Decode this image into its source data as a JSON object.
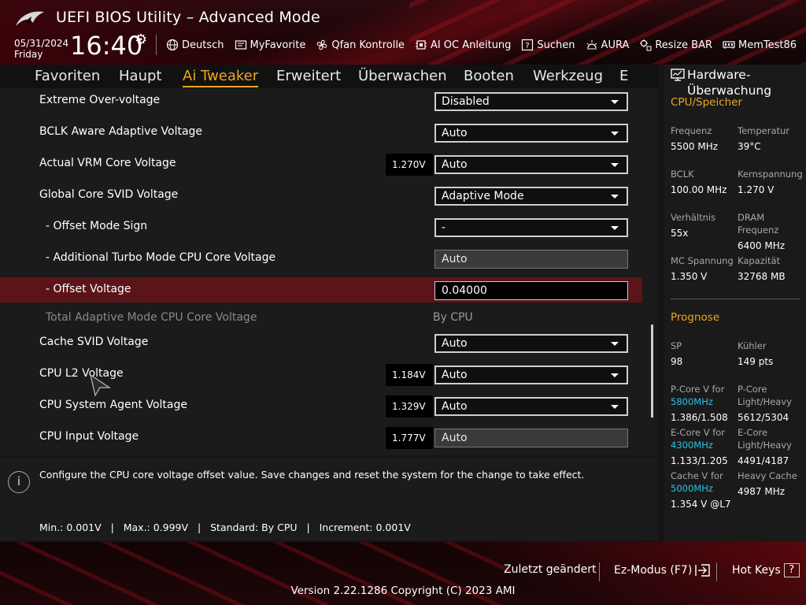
{
  "header": {
    "title": "UEFI BIOS Utility – Advanced Mode",
    "date": "05/31/2024",
    "day": "Friday",
    "time": "16:40",
    "quick_items": [
      {
        "icon": "globe-icon",
        "label": "Deutsch"
      },
      {
        "icon": "myfavorite-icon",
        "label": "MyFavorite"
      },
      {
        "icon": "fan-icon",
        "label": "Qfan Kontrolle"
      },
      {
        "icon": "ai-chip-icon",
        "label": "AI OC Anleitung"
      },
      {
        "icon": "search-help-icon",
        "label": "Suchen"
      },
      {
        "icon": "aura-lighting-icon",
        "label": "AURA"
      },
      {
        "icon": "resize-bar-icon",
        "label": "Resize BAR"
      },
      {
        "icon": "memtest-icon",
        "label": "MemTest86"
      }
    ]
  },
  "nav": {
    "tabs": [
      "Favoriten",
      "Haupt",
      "Ai Tweaker",
      "Erweitert",
      "Überwachen",
      "Booten",
      "Werkzeug",
      "E"
    ],
    "active": "Ai Tweaker"
  },
  "settings": [
    {
      "label": "Extreme Over-voltage",
      "type": "dropdown",
      "value": "Disabled"
    },
    {
      "label": "BCLK Aware Adaptive Voltage",
      "type": "dropdown",
      "value": "Auto"
    },
    {
      "label": "Actual VRM Core Voltage",
      "type": "dropdown",
      "value": "Auto",
      "reading": "1.270V"
    },
    {
      "label": "Global Core SVID Voltage",
      "type": "dropdown",
      "value": "Adaptive Mode"
    },
    {
      "label": "- Offset Mode Sign",
      "type": "dropdown",
      "value": "-"
    },
    {
      "label": "- Additional Turbo Mode CPU Core Voltage",
      "type": "field",
      "value": "Auto"
    },
    {
      "label": "- Offset Voltage",
      "type": "input",
      "value": "0.04000",
      "highlighted": true
    },
    {
      "label": "Total Adaptive Mode CPU Core Voltage",
      "type": "static",
      "value": "By CPU"
    },
    {
      "label": "Cache SVID Voltage",
      "type": "dropdown",
      "value": "Auto"
    },
    {
      "label": "CPU L2 Voltage",
      "type": "dropdown",
      "value": "Auto",
      "reading": "1.184V"
    },
    {
      "label": "CPU System Agent Voltage",
      "type": "dropdown",
      "value": "Auto",
      "reading": "1.329V"
    },
    {
      "label": "CPU Input Voltage",
      "type": "field",
      "value": "Auto",
      "reading": "1.777V"
    }
  ],
  "info": {
    "text": "Configure the CPU core voltage offset value. Save changes and reset the system for the change to take effect.",
    "limits": "Min.: 0.001V   |   Max.: 0.999V   |   Standard: By CPU   |   Increment: 0.001V"
  },
  "hw": {
    "title": "Hardware-Überwachung",
    "cpu_section": "CPU/Speicher",
    "frequenz_label": "Frequenz",
    "frequenz": "5500 MHz",
    "temperatur_label": "Temperatur",
    "temperatur": "39°C",
    "bclk_label": "BCLK",
    "bclk": "100.00 MHz",
    "kernspannung_label": "Kernspannung",
    "kernspannung": "1.270 V",
    "verhaeltnis_label": "Verhältnis",
    "verhaeltnis": "55x",
    "dram_label": "DRAM Frequenz",
    "dram": "6400 MHz",
    "mc_label": "MC Spannung",
    "mc": "1.350 V",
    "kapazitaet_label": "Kapazität",
    "kapazitaet": "32768 MB",
    "prognose_section": "Prognose",
    "sp_label": "SP",
    "sp": "98",
    "kuehler_label": "Kühler",
    "kuehler": "149 pts",
    "pcore_label": "P-Core V for",
    "pcore_freq": "5800MHz",
    "pcore": "1.386/1.508",
    "pcore_lh_label": "P-Core Light/Heavy",
    "pcore_lh": "5612/5304",
    "ecore_label": "E-Core V for",
    "ecore_freq": "4300MHz",
    "ecore": "1.133/1.205",
    "ecore_lh_label": "E-Core Light/Heavy",
    "ecore_lh": "4491/4187",
    "cache_label": "Cache V for",
    "cache_freq": "5000MHz",
    "cache": "1.354 V @L7",
    "heavy_cache_label": "Heavy Cache",
    "heavy_cache": "4987 MHz"
  },
  "footer": {
    "last_changed": "Zuletzt geändert",
    "ez_mode": "Ez-Modus (F7)",
    "hot_keys": "Hot Keys",
    "hot_keys_key": "?",
    "version": "Version 2.22.1286 Copyright (C) 2023 AMI"
  },
  "colors": {
    "accent": "#f0a51e",
    "highlight_row": "#5b1418",
    "cyan": "#27c4e6"
  }
}
